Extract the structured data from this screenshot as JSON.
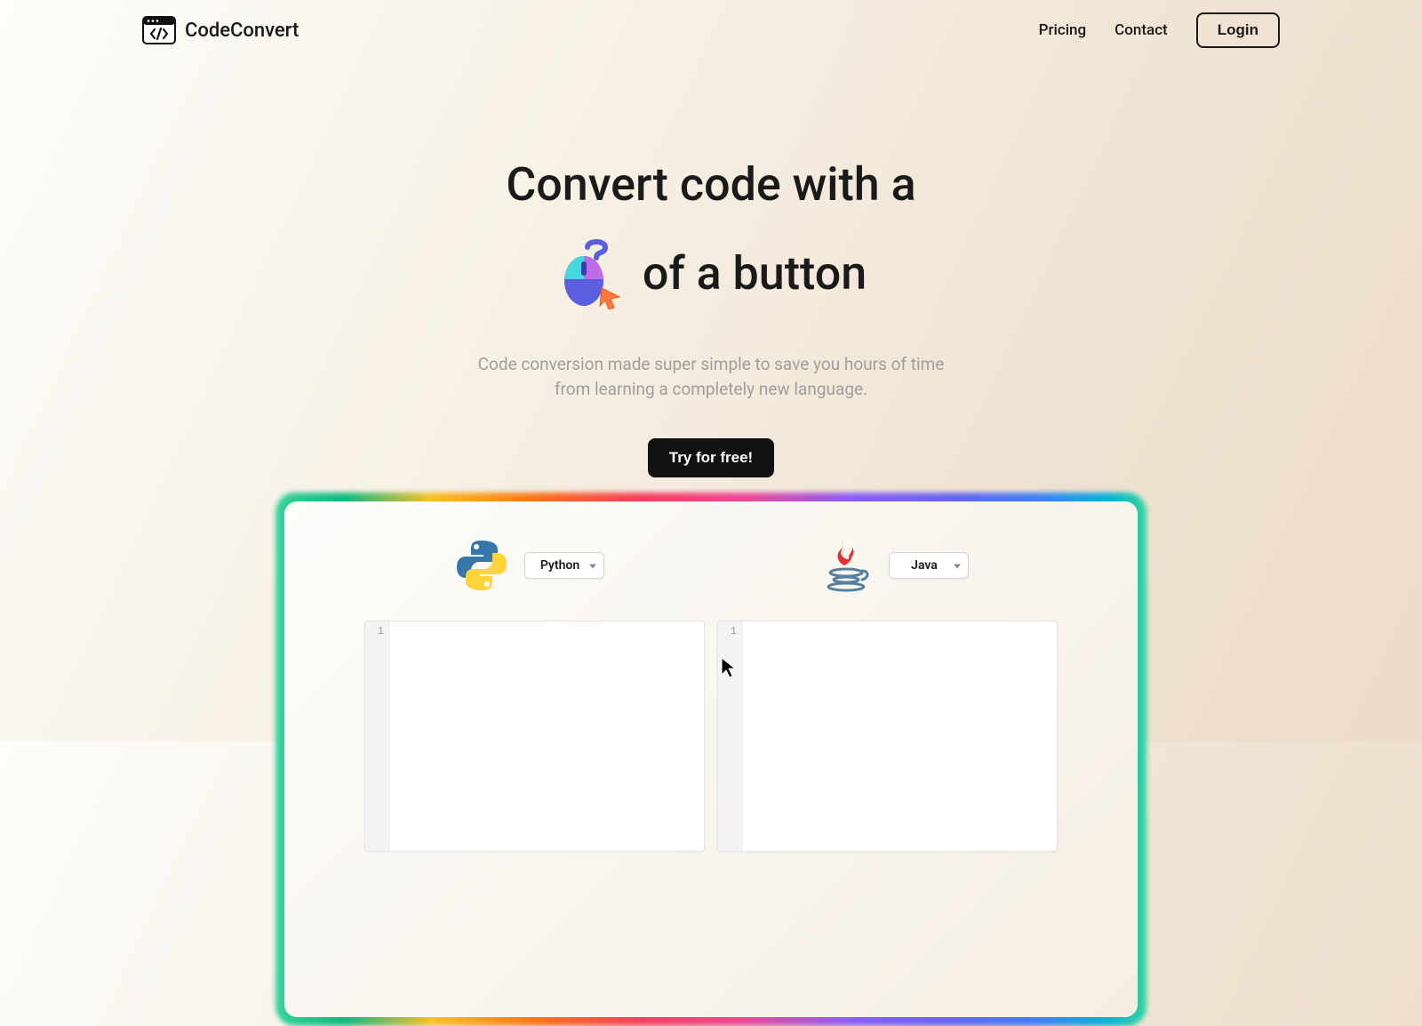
{
  "header": {
    "brand": "CodeConvert",
    "nav": {
      "pricing": "Pricing",
      "contact": "Contact",
      "login": "Login"
    }
  },
  "hero": {
    "headline_line1": "Convert code with a",
    "headline_line2_suffix": "of a button",
    "subtitle_line1": "Code conversion made super simple to save you hours of time",
    "subtitle_line2": "from learning a completely new language.",
    "cta": "Try for free!"
  },
  "demo": {
    "left": {
      "language": "Python",
      "line_number": "1"
    },
    "right": {
      "language": "Java",
      "line_number": "1"
    }
  }
}
